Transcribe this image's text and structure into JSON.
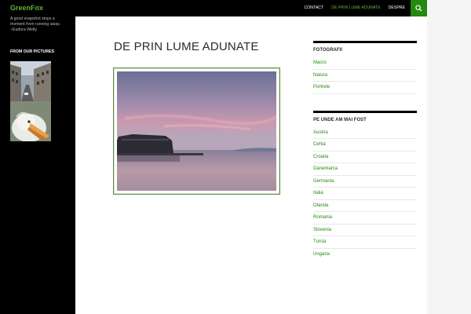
{
  "header": {
    "site_title": "GreenFox",
    "nav": [
      {
        "label": "CONTACT",
        "active": false
      },
      {
        "label": "DE PRIN LUME ADUNATE",
        "active": true
      },
      {
        "label": "DESPRE",
        "active": false
      }
    ],
    "search_icon": "search-icon"
  },
  "sidebar": {
    "tagline": "A good snapshot stops a moment from running away. ~Eudora Welty",
    "widget_title": "FROM OUR PICTURES"
  },
  "main": {
    "page_title": "DE PRIN LUME ADUNATE"
  },
  "right_sidebar": {
    "fotografii_title": "FOTOGRAFII",
    "fotografii": [
      "Macro",
      "Natura",
      "Portrete"
    ],
    "unde_title": "PE UNDE AM MAI FOST",
    "unde": [
      "Austria",
      "Cehia",
      "Croatia",
      "Danemarca",
      "Germania",
      "Italia",
      "Olanda",
      "Romania",
      "Slovenia",
      "Turcia",
      "Ungaria"
    ]
  },
  "colors": {
    "accent": "#24890d",
    "accent_light": "#60b437",
    "dark": "#000000"
  }
}
